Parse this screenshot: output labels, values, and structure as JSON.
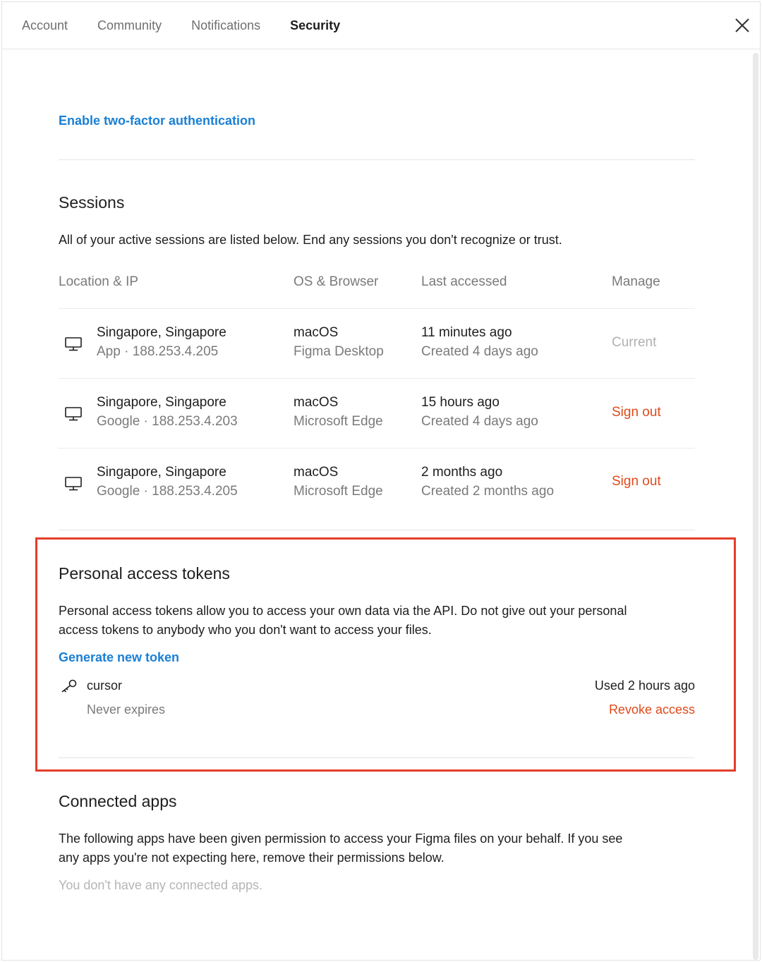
{
  "tabs": [
    {
      "label": "Account",
      "active": false
    },
    {
      "label": "Community",
      "active": false
    },
    {
      "label": "Notifications",
      "active": false
    },
    {
      "label": "Security",
      "active": true
    }
  ],
  "two_factor": {
    "label": "Enable two-factor authentication"
  },
  "sessions": {
    "title": "Sessions",
    "description": "All of your active sessions are listed below. End any sessions you don't recognize or trust.",
    "headers": {
      "location": "Location & IP",
      "os": "OS & Browser",
      "last": "Last accessed",
      "manage": "Manage"
    },
    "rows": [
      {
        "location": "Singapore, Singapore",
        "source": "App · 188.253.4.205",
        "os": "macOS",
        "browser": "Figma Desktop",
        "last": "11 minutes ago",
        "created": "Created 4 days ago",
        "manage": "Current"
      },
      {
        "location": "Singapore, Singapore",
        "source": "Google · 188.253.4.203",
        "os": "macOS",
        "browser": "Microsoft Edge",
        "last": "15 hours ago",
        "created": "Created 4 days ago",
        "manage": "Sign out"
      },
      {
        "location": "Singapore, Singapore",
        "source": "Google · 188.253.4.205",
        "os": "macOS",
        "browser": "Microsoft Edge",
        "last": "2 months ago",
        "created": "Created 2 months ago",
        "manage": "Sign out"
      }
    ]
  },
  "tokens": {
    "title": "Personal access tokens",
    "description_line1": "Personal access tokens allow you to access your own data via the API. Do not give out your personal",
    "description_line2": "access tokens to anybody who you don't want to access your files.",
    "generate_label": "Generate new token",
    "items": [
      {
        "name": "cursor",
        "expires": "Never expires",
        "used": "Used 2 hours ago",
        "revoke_label": "Revoke access"
      }
    ]
  },
  "connected_apps": {
    "title": "Connected apps",
    "description_line1": "The following apps have been given permission to access your Figma files on your behalf. If you see",
    "description_line2": "any apps you're not expecting here, remove their permissions below.",
    "empty": "You don't have any connected apps."
  },
  "colors": {
    "link": "#1a7fd4",
    "danger": "#e04a1a",
    "highlight": "#e53d2b"
  }
}
